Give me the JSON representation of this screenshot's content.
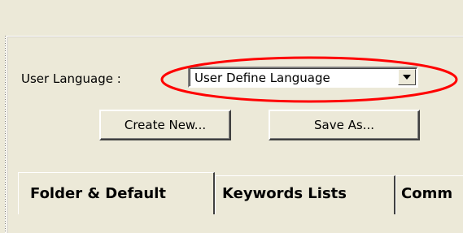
{
  "language_panel": {
    "label": "User Language :",
    "selected_language": "User Define Language"
  },
  "actions": {
    "create_new": "Create New...",
    "save_as": "Save As..."
  },
  "tabs": [
    {
      "label": "Folder & Default"
    },
    {
      "label": "Keywords Lists"
    },
    {
      "label": "Comm"
    }
  ],
  "colors": {
    "window_background": "#ece9d8",
    "highlight_outline": "#ff0000"
  }
}
